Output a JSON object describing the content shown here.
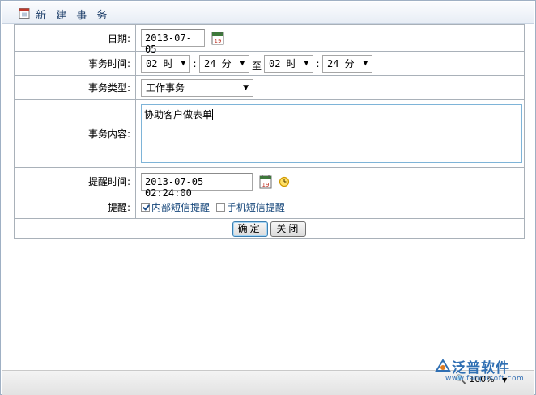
{
  "window": {
    "title": "新 建 事 务"
  },
  "form": {
    "date_label": "日期:",
    "date_value": "2013-07-05",
    "time_label": "事务时间:",
    "start_hour": "02 时",
    "start_minute": "24 分",
    "to_label": "至",
    "end_hour": "02 时",
    "end_minute": "24 分",
    "colon": ":",
    "type_label": "事务类型:",
    "type_value": "工作事务",
    "content_label": "事务内容:",
    "content_value": "协助客户做表单",
    "reminder_time_label": "提醒时间:",
    "reminder_time_value": "2013-07-05 02:24:00",
    "reminder_label": "提醒:",
    "internal_sms_label": "内部短信提醒",
    "internal_sms_checked": true,
    "mobile_sms_label": "手机短信提醒",
    "mobile_sms_checked": false
  },
  "buttons": {
    "ok": "确定",
    "close": "关闭"
  },
  "statusbar": {
    "zoom": "100%"
  },
  "watermark": {
    "brand": "泛普软件",
    "url": "www.fanpusoft.com"
  },
  "colors": {
    "accent": "#2f6fb3",
    "title_text": "#1e3f6a",
    "border": "#a9b1b9"
  }
}
